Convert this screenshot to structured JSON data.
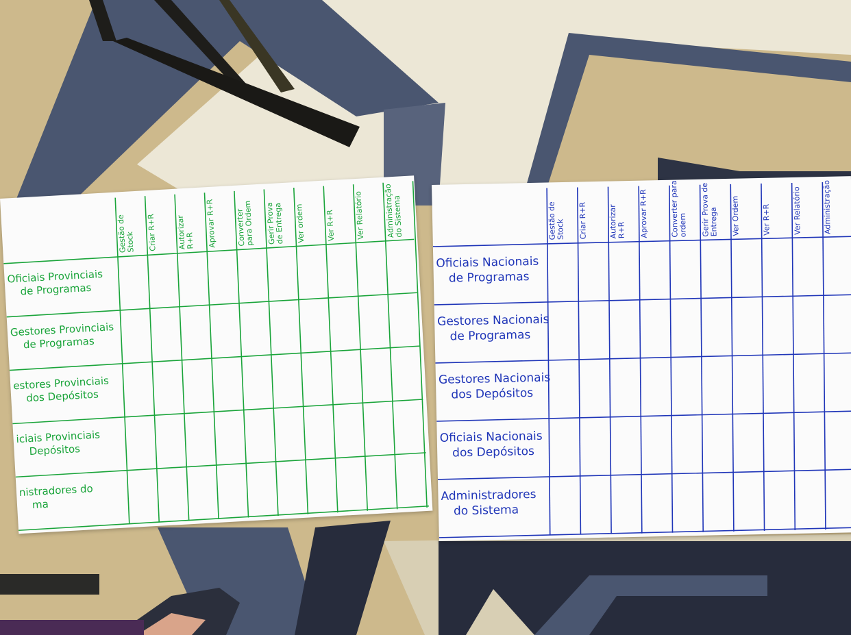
{
  "left_sheet": {
    "ink_color": "#1aa43a",
    "columns": [
      [
        "Gestão de",
        "Stock"
      ],
      [
        "Criar R+R"
      ],
      [
        "Autorizar",
        "R+R"
      ],
      [
        "Aprovar R+R"
      ],
      [
        "Converter",
        "para Ordem"
      ],
      [
        "Gerir Prova",
        "de Entrega"
      ],
      [
        "Ver ordem"
      ],
      [
        "Ver R+R"
      ],
      [
        "Ver Relatório"
      ],
      [
        "Administração",
        "do Sistema"
      ]
    ],
    "rows": [
      [
        "Oficiais Provinciais",
        "de Programas"
      ],
      [
        "Gestores Provinciais",
        "de Programas"
      ],
      [
        "estores Provinciais",
        "dos Depósitos"
      ],
      [
        "iciais Provinciais",
        "Depósitos"
      ],
      [
        "nistradores do",
        "ma"
      ]
    ]
  },
  "right_sheet": {
    "ink_color": "#1f35b8",
    "columns": [
      [
        "Gestão de",
        "Stock"
      ],
      [
        "Criar R+R"
      ],
      [
        "Autorizar",
        "R+R"
      ],
      [
        "Aprovar R+R"
      ],
      [
        "Converter para",
        "ordem"
      ],
      [
        "Gerir Prova de",
        "Entrega"
      ],
      [
        "Ver Ordem"
      ],
      [
        "Ver R+R"
      ],
      [
        "Ver Relatório"
      ],
      [
        "Administração"
      ]
    ],
    "rows": [
      [
        "Oficiais Nacionais",
        "de Programas"
      ],
      [
        "Gestores Nacionais",
        "de Programas"
      ],
      [
        "Gestores Nacionais",
        "dos Depósitos"
      ],
      [
        "Oficiais Nacionais",
        "dos Depósitos"
      ],
      [
        "Administradores",
        "do Sistema"
      ]
    ]
  },
  "colors": {
    "carpet_tan": "#cdb98c",
    "carpet_cream": "#ece7d6",
    "carpet_blue": "#4a5670",
    "carpet_dark": "#272c3c"
  }
}
